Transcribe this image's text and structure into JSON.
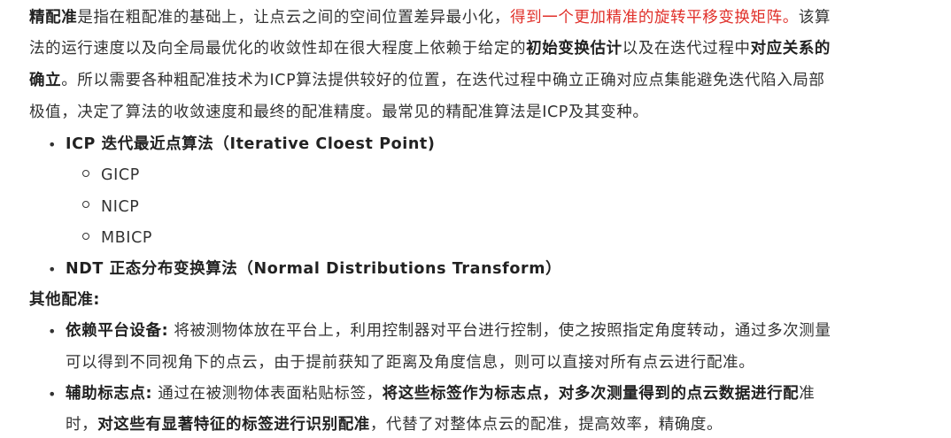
{
  "paragraph": {
    "l1_bold": "精配准",
    "l1_text": "是指在粗配准的基础上，让点云之间的空间位置差异最小化，",
    "l1_red": "得到一个更加精准的旋转平移变换矩阵。",
    "l1_tail": "该算",
    "l2_text": "法的运行速度以及向全局最优化的收敛性却在很大程度上依赖于给定的",
    "l2_bold1": "初始变换估计",
    "l2_mid": "以及在迭代过程中",
    "l2_bold2": "对应关系的",
    "l3_bold": "确立",
    "l3_text": "。所以需要各种粗配准技术为ICP算法提供较好的位置，在迭代过程中确立正确对应点集能避免迭代陷入局部",
    "l4_text": "极值，决定了算法的收敛速度和最终的配准精度。最常见的精配准算法是ICP及其变种。"
  },
  "list1": {
    "icp": "ICP 迭代最近点算法（Iterative Cloest Point)",
    "sub": [
      "GICP",
      "NICP",
      "MBICP"
    ],
    "ndt": "NDT 正态分布变换算法（Normal Distributions Transform）"
  },
  "other": {
    "heading": "其他配准:",
    "item1_bold": "依赖平台设备:",
    "item1_text": " 将被测物体放在平台上，利用控制器对平台进行控制，使之按照指定角度转动，通过多次测量",
    "item1_line2": "可以得到不同视角下的点云，由于提前获知了距离及角度信息，则可以直接对所有点云进行配准。",
    "item2_bold": "辅助标志点:",
    "item2_text": " 通过在被测物体表面粘贴标签，",
    "item2_bold2": "将这些标签作为标志点，对多次测量得到的点云数据进行配",
    "item2_tail": "准",
    "item2_l2_pre": "时，",
    "item2_l2_bold": "对这些有显著特征的标签进行识别配准",
    "item2_l2_text": "，代替了对整体点云的配准，提高效率，精确度。"
  },
  "colors": {
    "text": "#333333",
    "highlight": "#e0302a"
  }
}
